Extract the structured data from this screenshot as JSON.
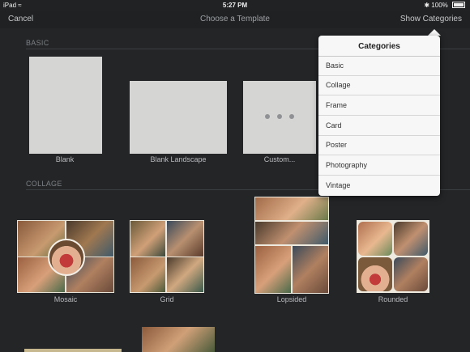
{
  "status_bar": {
    "device": "iPad",
    "wifi_icon": "wifi-icon",
    "time": "5:27 PM",
    "battery": "100%"
  },
  "nav": {
    "cancel_label": "Cancel",
    "title": "Choose a Template",
    "show_categories_label": "Show Categories"
  },
  "sections": {
    "basic": "BASIC",
    "collage": "COLLAGE"
  },
  "basic_templates": [
    {
      "label": "Blank"
    },
    {
      "label": "Blank Landscape"
    },
    {
      "label": "Custom..."
    }
  ],
  "collage_templates": [
    {
      "label": "Mosaic"
    },
    {
      "label": "Grid"
    },
    {
      "label": "Lopsided"
    },
    {
      "label": "Rounded"
    }
  ],
  "categories_popover": {
    "title": "Categories",
    "items": [
      "Basic",
      "Collage",
      "Frame",
      "Card",
      "Poster",
      "Photography",
      "Vintage"
    ]
  },
  "colors": {
    "background": "#232527",
    "popover": "#f7f7f7",
    "thumbnail": "#d5d5d4"
  }
}
